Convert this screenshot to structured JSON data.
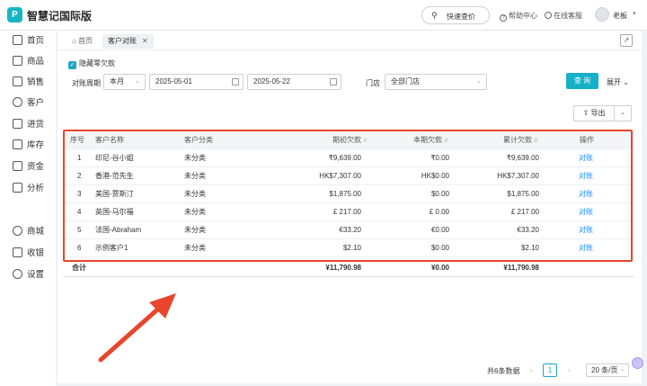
{
  "app": {
    "logo": "P",
    "title": "智慧记国际版"
  },
  "topbar": {
    "search_label": "快速查价",
    "help_label": "帮助中心",
    "service_label": "在线客服",
    "user_name": "老板"
  },
  "sidebar": {
    "items": [
      {
        "label": "首页",
        "icon": "home-icon"
      },
      {
        "label": "商品",
        "icon": "box-icon"
      },
      {
        "label": "销售",
        "icon": "sales-icon"
      },
      {
        "label": "客户",
        "icon": "user-icon"
      },
      {
        "label": "进货",
        "icon": "purchase-icon"
      },
      {
        "label": "库存",
        "icon": "warehouse-icon"
      },
      {
        "label": "资金",
        "icon": "money-icon"
      },
      {
        "label": "分析",
        "icon": "chart-icon"
      },
      {
        "label": "商城",
        "icon": "shop-icon"
      },
      {
        "label": "收银",
        "icon": "cashier-icon"
      },
      {
        "label": "设置",
        "icon": "gear-icon"
      }
    ]
  },
  "tabs": [
    {
      "label": "首页"
    },
    {
      "label": "客户对账"
    }
  ],
  "filters": {
    "hide_zero_label": "隐藏零欠款",
    "period_label": "对账周期",
    "period_value": "本月",
    "date_start": "2025-05-01",
    "date_end": "2025-05-22",
    "store_label": "门店",
    "store_value": "全部门店",
    "query_label": "查 询",
    "expand_label": "展开"
  },
  "toolbar": {
    "export_label": "导出"
  },
  "table": {
    "headers": [
      "序号",
      "客户名称",
      "客户分类",
      "期初欠款",
      "本期欠款",
      "累计欠款",
      "操作"
    ],
    "rows": [
      [
        "1",
        "印尼-谷小姐",
        "未分类",
        "₹9,639.00",
        "₹0.00",
        "₹9,639.00",
        "对账"
      ],
      [
        "2",
        "香港-范先生",
        "未分类",
        "HK$7,307.00",
        "HK$0.00",
        "HK$7,307.00",
        "对账"
      ],
      [
        "3",
        "美国-贾斯汀",
        "未分类",
        "$1,875.00",
        "$0.00",
        "$1,875.00",
        "对账"
      ],
      [
        "4",
        "英国-马尔福",
        "未分类",
        "£ 217.00",
        "£ 0.00",
        "£ 217.00",
        "对账"
      ],
      [
        "5",
        "法国-Abraham",
        "未分类",
        "€33.20",
        "€0.00",
        "€33.20",
        "对账"
      ],
      [
        "6",
        "示例客户1",
        "未分类",
        "$2.10",
        "$0.00",
        "$2.10",
        "对账"
      ]
    ],
    "total": {
      "label": "合计",
      "opening": "¥11,790.98",
      "current": "¥0.00",
      "cumulative": "¥11,790.98"
    }
  },
  "pagination": {
    "total_text": "共6条数据",
    "prev": "‹",
    "page": "1",
    "next": "›",
    "page_size": "20 条/页"
  },
  "colors": {
    "accent": "#17b0c9",
    "link": "#1890ff",
    "highlight": "#e8452c"
  }
}
